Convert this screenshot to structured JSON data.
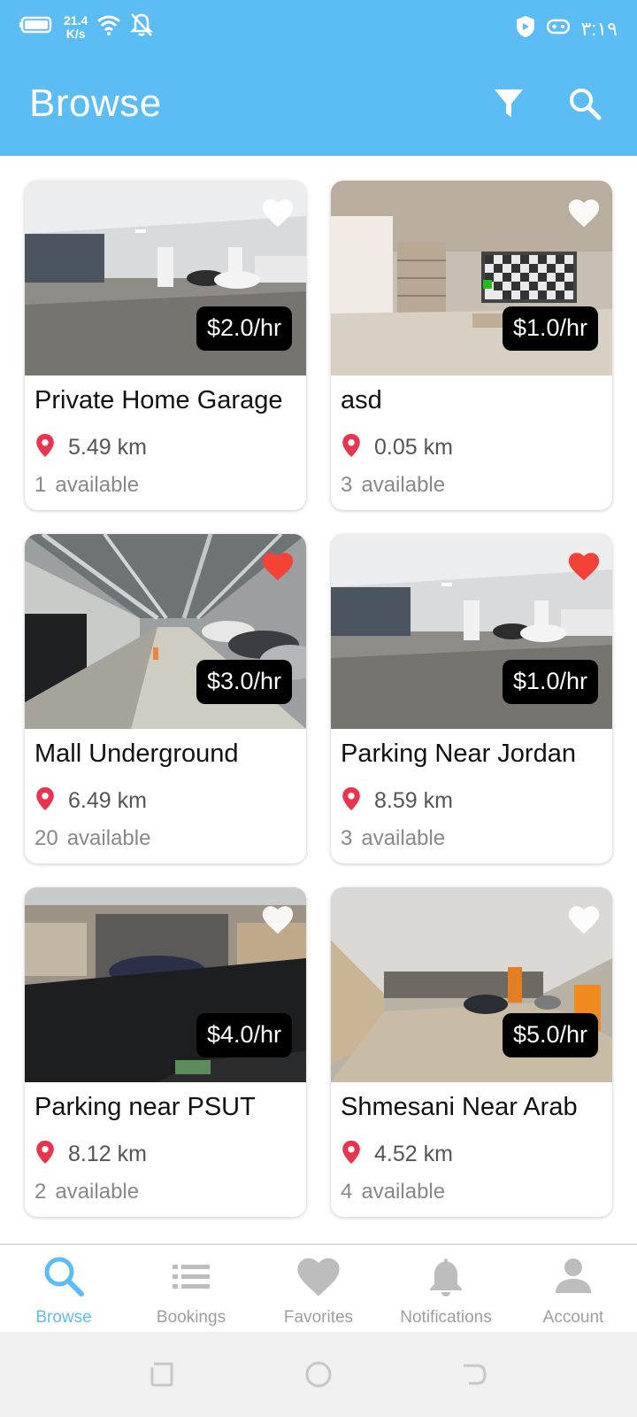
{
  "status_bar": {
    "speed_value": "21.4",
    "speed_unit": "K/s",
    "time": "٣:١٩"
  },
  "app_bar": {
    "title": "Browse",
    "icons": [
      "filter-icon",
      "search-icon"
    ]
  },
  "listings": [
    {
      "name": "Private Home Garage",
      "price": "$2.0/hr",
      "distance": "5.49 km",
      "available_count": "1",
      "available_label": "available",
      "favorite": false
    },
    {
      "name": "asd",
      "price": "$1.0/hr",
      "distance": "0.05 km",
      "available_count": "3",
      "available_label": "available",
      "favorite": false
    },
    {
      "name": "Mall Underground",
      "price": "$3.0/hr",
      "distance": "6.49 km",
      "available_count": "20",
      "available_label": "available",
      "favorite": true
    },
    {
      "name": "Parking Near Jordan",
      "price": "$1.0/hr",
      "distance": "8.59 km",
      "available_count": "3",
      "available_label": "available",
      "favorite": true
    },
    {
      "name": "Parking near PSUT",
      "price": "$4.0/hr",
      "distance": "8.12 km",
      "available_count": "2",
      "available_label": "available",
      "favorite": false
    },
    {
      "name": "Shmesani Near Arab",
      "price": "$5.0/hr",
      "distance": "4.52 km",
      "available_count": "4",
      "available_label": "available",
      "favorite": false
    }
  ],
  "bottom_nav": [
    {
      "label": "Browse",
      "icon": "search-icon",
      "active": true
    },
    {
      "label": "Bookings",
      "icon": "list-icon",
      "active": false
    },
    {
      "label": "Favorites",
      "icon": "heart-icon",
      "active": false
    },
    {
      "label": "Notifications",
      "icon": "bell-icon",
      "active": false
    },
    {
      "label": "Account",
      "icon": "person-icon",
      "active": false
    }
  ],
  "colors": {
    "primary": "#5BBDF3",
    "favorite_active": "#F44336",
    "favorite_inactive": "#FFFFFF",
    "pin": "#E8344E",
    "price_badge": "#000000"
  }
}
